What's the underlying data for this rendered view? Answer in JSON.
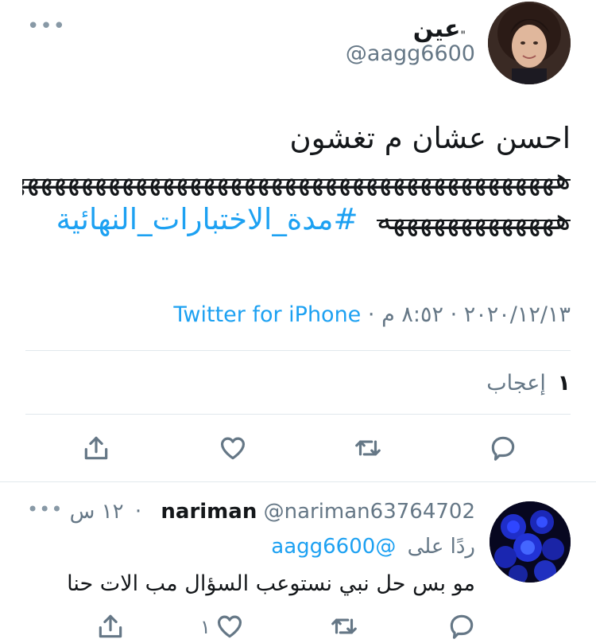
{
  "tweet": {
    "display_name": "عين",
    "display_name_mark": "\"",
    "handle": "@aagg6600",
    "more_label": "•••",
    "text_line1": "احسن عشان م تغشون",
    "text_line2_strike": "هههههههههههههههههههههههههههههههههههههههههه",
    "text_line3_strike": "هههههههههههههه",
    "hashtag": "#مدة_الاختبارات_النهائية",
    "date": "٢٠٢٠/١٢/١٣",
    "time": "٨:٥٢ م",
    "separator": "·",
    "source": "Twitter for iPhone",
    "likes_count": "١",
    "likes_label": "إعجاب",
    "actions": {
      "reply_icon": "comment-icon",
      "retweet_icon": "retweet-icon",
      "like_icon": "heart-icon",
      "share_icon": "share-icon"
    }
  },
  "reply": {
    "display_name": "nariman",
    "handle": "@nariman63764702",
    "separator": "·",
    "time": "١٢ س",
    "more_label": "•••",
    "replying_to_label": "ردًا على",
    "replying_to_handle": "@aagg6600",
    "text": "مو بس حل نبي نستوعب السؤال مب الات حنا",
    "like_count": "١"
  },
  "colors": {
    "accent": "#1da1f2",
    "text": "#14171a",
    "muted": "#657786",
    "divider": "#e1e8ed"
  }
}
